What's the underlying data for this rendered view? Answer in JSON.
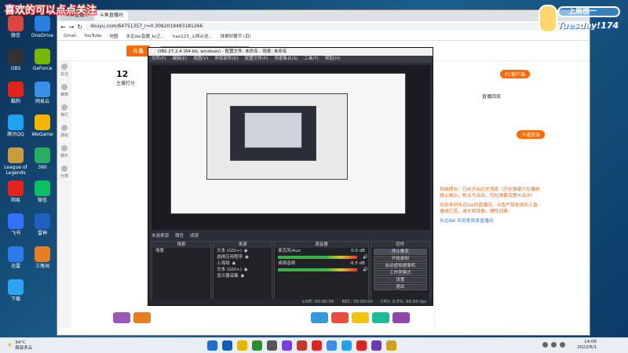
{
  "overlay": {
    "left_text": "喜欢的可以点点关注",
    "right_rank": "上周榜一",
    "right_day": "Tuesday!174"
  },
  "desktop_icons": [
    {
      "label": "微信",
      "color": "#d44"
    },
    {
      "label": "OneDrive",
      "color": "#2a7de1"
    },
    {
      "label": "OBS",
      "color": "#333"
    },
    {
      "label": "GeForce",
      "color": "#76b900"
    },
    {
      "label": "酷狗",
      "color": "#e2231a"
    },
    {
      "label": "网易云",
      "color": "#3b8eea"
    },
    {
      "label": "腾讯QQ",
      "color": "#1fa2f2"
    },
    {
      "label": "WeGame",
      "color": "#f4b400"
    },
    {
      "label": "League of Legends",
      "color": "#c89b3c"
    },
    {
      "label": "360",
      "color": "#27ae60"
    },
    {
      "label": "网易",
      "color": "#e2231a"
    },
    {
      "label": "微信",
      "color": "#07c160"
    },
    {
      "label": "飞书",
      "color": "#3370ff"
    },
    {
      "label": "雷神",
      "color": "#1f5fbf"
    },
    {
      "label": "迅雷",
      "color": "#2b7de9"
    },
    {
      "label": "三角洲",
      "color": "#e67e22"
    },
    {
      "label": "下载",
      "color": "#2ea3f2"
    }
  ],
  "browser": {
    "tabs": [
      "斗鱼直播...",
      "斗鱼直播间"
    ],
    "url": "douyu.com/64751357_r=0.3092019493181266",
    "bookmarks": [
      "Gmail",
      "YouTube",
      "地图",
      "永远dai直播_b(正...",
      "hao123_上网从这...",
      "体更好趣节 (目)"
    ],
    "nav_items": [
      "关注",
      "推荐",
      "排行",
      "游戏",
      "娱乐",
      "分类"
    ],
    "room_number": "12",
    "room_label": "主播打分",
    "right_header": "直播回放",
    "pc_button": "PC客户端",
    "follow_button": "开通贵族",
    "chat": [
      {
        "kind": "sys",
        "text": "系统提示：已经开启历史消息（历史弹幕只在播放器上展示，默认为关闭，可在弹幕设置中关闭）"
      },
      {
        "kind": "sys",
        "text": "欢迎来到永远dai的直播间。斗鱼严禁未成年人直播或打赏，请文明观看，理性消费。"
      },
      {
        "kind": "blue",
        "text": "永远dai 欢迎来到本直播间"
      }
    ]
  },
  "obs": {
    "title": "OBS 27.2.4 (64-bit, windows) - 配置文件: 未命名 - 场景: 未命名",
    "menu": [
      "文件(F)",
      "编辑(E)",
      "视图(V)",
      "停靠部件(D)",
      "配置文件(P)",
      "场景集合(S)",
      "工具(T)",
      "帮助(H)"
    ],
    "status_line": [
      "未选择源",
      "属性",
      "滤镜"
    ],
    "docks": {
      "scenes": {
        "title": "场景",
        "items": [
          "场景"
        ]
      },
      "sources": {
        "title": "来源",
        "items": [
          "文本 (GDI+)",
          "选择应用程序",
          "上海钱",
          "文本 (GDI+)",
          "显示器采集"
        ]
      },
      "mixer": {
        "title": "混音器",
        "items": [
          {
            "name": "麦克风/Aux",
            "db": "0.0 dB"
          },
          {
            "name": "桌面音频",
            "db": "-6.5 dB"
          }
        ]
      },
      "controls": {
        "title": "控件",
        "items": [
          "停止推流",
          "开始录制",
          "启动虚拟摄像机",
          "工作室模式",
          "设置",
          "退出"
        ]
      }
    },
    "bottom": [
      "LIVE: 00:00:00",
      "REC: 00:00:00",
      "CPU: 0.0%, 60.00 fps"
    ]
  },
  "taskbar": {
    "weather": {
      "temp": "34°C",
      "desc": "局部多云"
    },
    "time": "14:08",
    "date": "2022/6/1",
    "icons": [
      "#1f6fd1",
      "#0f5fb8",
      "#e8b400",
      "#2a8f2a",
      "#555",
      "#7c3aed",
      "#c0392b",
      "#e2231a",
      "#3b8eea",
      "#1fa2f2",
      "#e2231a",
      "#6a3ab2",
      "#d0a020"
    ]
  }
}
